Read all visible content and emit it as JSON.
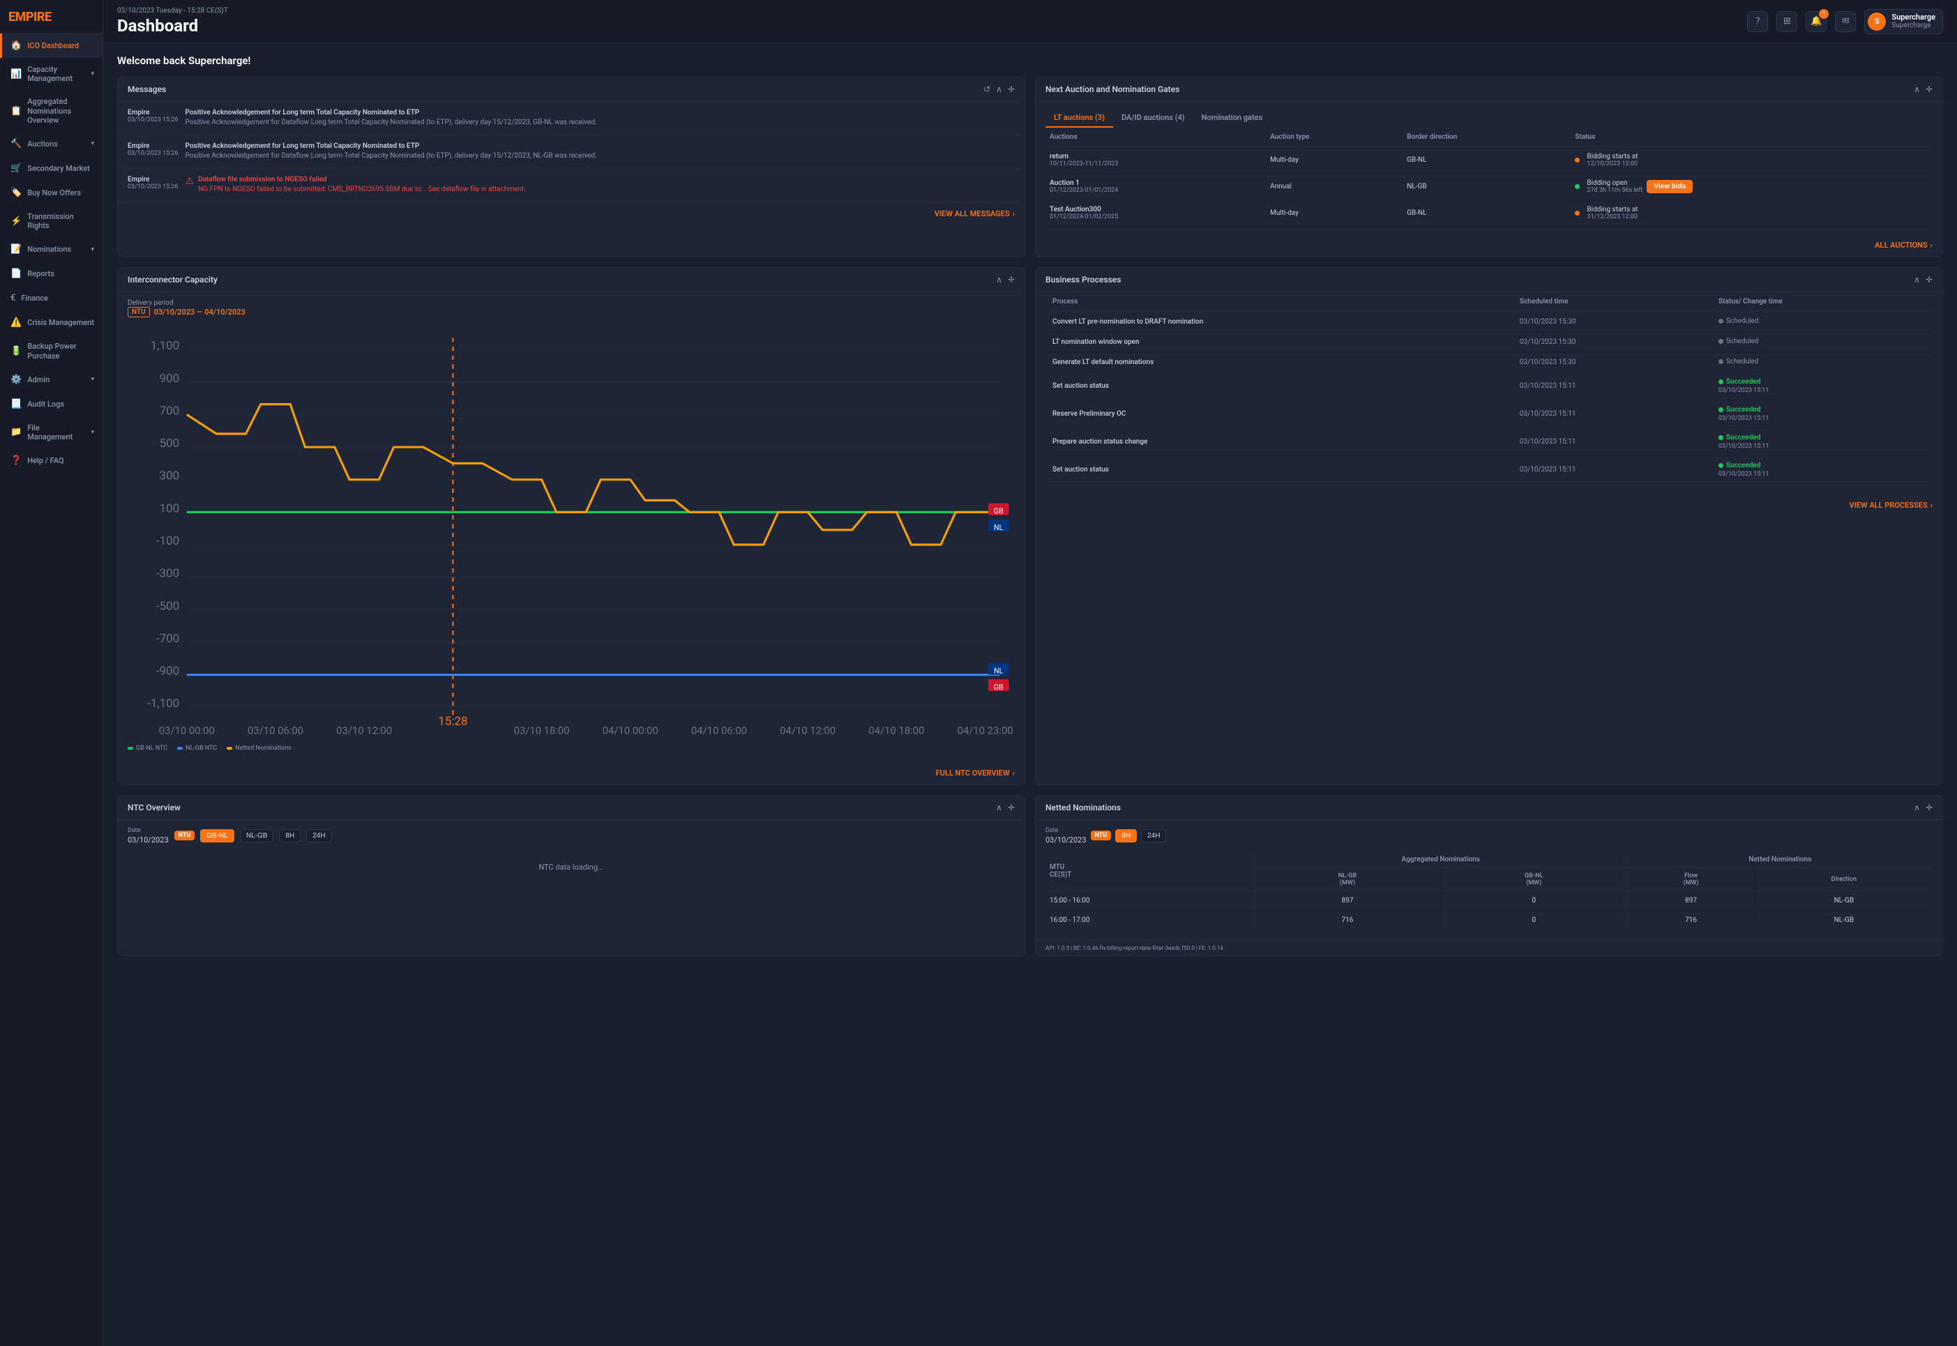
{
  "logo": {
    "text": "EMPIR",
    "accent": "E"
  },
  "header": {
    "datetime": "03/10/2023 Tuesday - 15:28 CE(S)T",
    "title": "Dashboard",
    "user": {
      "name": "Supercharge",
      "sub": "Supercharge",
      "initial": "S"
    }
  },
  "welcome": "Welcome back Supercharge!",
  "sidebar": {
    "items": [
      {
        "id": "ico-dashboard",
        "icon": "🏠",
        "label": "ICO Dashboard",
        "active": true,
        "chevron": false
      },
      {
        "id": "capacity-management",
        "icon": "📊",
        "label": "Capacity Management",
        "active": false,
        "chevron": true
      },
      {
        "id": "aggregated-nominations",
        "icon": "📋",
        "label": "Aggregated Nominations Overview",
        "active": false,
        "chevron": false
      },
      {
        "id": "auctions",
        "icon": "🔨",
        "label": "Auctions",
        "active": false,
        "chevron": true
      },
      {
        "id": "secondary-market",
        "icon": "🛒",
        "label": "Secondary Market",
        "active": false,
        "chevron": false
      },
      {
        "id": "buy-now-offers",
        "icon": "🏷️",
        "label": "Buy Now Offers",
        "active": false,
        "chevron": false
      },
      {
        "id": "transmission-rights",
        "icon": "⚡",
        "label": "Transmission Rights",
        "active": false,
        "chevron": false
      },
      {
        "id": "nominations",
        "icon": "📝",
        "label": "Nominations",
        "active": false,
        "chevron": true
      },
      {
        "id": "reports",
        "icon": "📄",
        "label": "Reports",
        "active": false,
        "chevron": false
      },
      {
        "id": "finance",
        "icon": "€",
        "label": "Finance",
        "active": false,
        "chevron": false
      },
      {
        "id": "crisis-management",
        "icon": "⚠️",
        "label": "Crisis Management",
        "active": false,
        "chevron": false
      },
      {
        "id": "backup-power",
        "icon": "🔋",
        "label": "Backup Power Purchase",
        "active": false,
        "chevron": false
      },
      {
        "id": "admin",
        "icon": "⚙️",
        "label": "Admin",
        "active": false,
        "chevron": true
      },
      {
        "id": "audit-logs",
        "icon": "📃",
        "label": "Audit Logs",
        "active": false,
        "chevron": false
      },
      {
        "id": "file-management",
        "icon": "📁",
        "label": "File Management",
        "active": false,
        "chevron": true
      },
      {
        "id": "help",
        "icon": "❓",
        "label": "Help / FAQ",
        "active": false,
        "chevron": false
      }
    ]
  },
  "messages": {
    "title": "Messages",
    "items": [
      {
        "sender": "Empire",
        "time": "03/10/2023 15:26",
        "title": "Positive Acknowledgement for Long term Total Capacity Nominated to ETP",
        "body": "Positive Acknowledgement for Dataflow Long term Total Capacity Nominated (to ETP), delivery day 15/12/2023, GB-NL was received.",
        "error": false
      },
      {
        "sender": "Empire",
        "time": "03/10/2023 15:26",
        "title": "Positive Acknowledgement for Long term Total Capacity Nominated to ETP",
        "body": "Positive Acknowledgement for Dataflow Long term Total Capacity Nominated (to ETP), delivery day 15/12/2023, NL-GB was received.",
        "error": false
      },
      {
        "sender": "Empire",
        "time": "03/10/2023 15:26",
        "title": "Dataflow file submission to NGESO failed",
        "body": "NG FPN to NGESO failed to be submitted: CMS_BRTND2695.SBM due to: . See dataflow file in attachment.",
        "error": true
      }
    ],
    "view_all": "VIEW ALL MESSAGES"
  },
  "auctions": {
    "title": "Next Auction and Nomination Gates",
    "tabs": [
      {
        "id": "lt",
        "label": "LT auctions (3)",
        "active": true
      },
      {
        "id": "da-id",
        "label": "DA/ID auctions (4)",
        "active": false
      },
      {
        "id": "nomination-gates",
        "label": "Nomination gates",
        "active": false
      }
    ],
    "columns": [
      "Auctions",
      "Auction type",
      "Border direction",
      "Status"
    ],
    "rows": [
      {
        "name": "return",
        "dates": "10/11/2023-11/11/2023",
        "type": "Multi-day",
        "border": "GB-NL",
        "status": "Bidding starts at",
        "status_date": "12/10/2023 12:00",
        "status_type": "orange",
        "has_btn": false
      },
      {
        "name": "Auction 1",
        "dates": "01/12/2023-01/01/2024",
        "type": "Annual",
        "border": "NL-GB",
        "status": "Bidding open",
        "status_date": "27d 3h 11m 56s left",
        "status_type": "green",
        "has_btn": true
      },
      {
        "name": "Test Auction300",
        "dates": "01/12/2024-01/02/2025",
        "type": "Multi-day",
        "border": "GB-NL",
        "status": "Bidding starts at",
        "status_date": "31/12/2023 12:00",
        "status_type": "orange",
        "has_btn": false
      }
    ],
    "all_label": "ALL AUCTIONS",
    "btn_label": "View bids"
  },
  "chart": {
    "title": "Interconnector Capacity",
    "delivery_label": "Delivery period",
    "date_range": "03/10/2023 — 04/10/2023",
    "legend": [
      {
        "color": "#22c55e",
        "label": "GB-NL NTC"
      },
      {
        "color": "#3b82f6",
        "label": "NL-GB NTC"
      },
      {
        "color": "#f59e0b",
        "label": "Netted Nominations"
      }
    ],
    "full_link": "FULL NTC OVERVIEW",
    "y_labels": [
      "1,100",
      "900",
      "700",
      "500",
      "300",
      "100",
      "-100",
      "-300",
      "-500",
      "-700",
      "-900",
      "-1,100"
    ],
    "x_labels": [
      "03/10 00:00",
      "03/10 06:00",
      "03/10 12:00",
      "15:28",
      "03/10 18:00",
      "04/10 00:00",
      "04/10 06:00",
      "04/10 12:00",
      "04/10 18:00",
      "04/10 23:00"
    ]
  },
  "business_processes": {
    "title": "Business Processes",
    "columns": [
      "Process",
      "Scheduled time",
      "Status/ Change time"
    ],
    "rows": [
      {
        "name": "Convert LT pre-nomination to DRAFT nomination",
        "time": "03/10/2023 15:30",
        "status": "Scheduled",
        "status_time": "",
        "type": "scheduled"
      },
      {
        "name": "LT nomination window open",
        "time": "03/10/2023 15:30",
        "status": "Scheduled",
        "status_time": "",
        "type": "scheduled"
      },
      {
        "name": "Generate LT default nominations",
        "time": "03/10/2023 15:30",
        "status": "Scheduled",
        "status_time": "",
        "type": "scheduled"
      },
      {
        "name": "Set auction status",
        "time": "03/10/2023 15:11",
        "status": "Succeeded",
        "status_time": "03/10/2023 15:11",
        "type": "succeeded"
      },
      {
        "name": "Reserve Preliminary OC",
        "time": "03/10/2023 15:11",
        "status": "Succeeded",
        "status_time": "03/10/2023 15:11",
        "type": "succeeded"
      },
      {
        "name": "Prepare auction status change",
        "time": "03/10/2023 15:11",
        "status": "Succeeded",
        "status_time": "03/10/2023 15:11",
        "type": "succeeded"
      },
      {
        "name": "Set auction status",
        "time": "03/10/2023 15:11",
        "status": "Succeeded",
        "status_time": "03/10/2023 15:11",
        "type": "succeeded"
      }
    ],
    "view_all": "VIEW ALL PROCESSES"
  },
  "ntc_overview": {
    "title": "NTC Overview",
    "date_label": "Date",
    "date_value": "03/10/2023",
    "filters": [
      "NTU",
      "GB-NL",
      "NL-GB",
      "8H",
      "24H"
    ]
  },
  "netted_nominations": {
    "title": "Netted Nominations",
    "date_label": "Date",
    "date_value": "03/10/2023",
    "time_filters": [
      "NTU",
      "8H",
      "24H"
    ],
    "active_filter": "8H",
    "agg_nom_label": "Aggregated Nominations",
    "netted_nom_label": "Netted Nominations",
    "cols": {
      "mtu": "MTU CE(S)T",
      "nl_gb": "NL-GB (MW)",
      "gb_nl": "GB-NL (MW)",
      "flow": "Flow (MW)",
      "direction": "Direction"
    },
    "rows": [
      {
        "time": "15:00 - 16:00",
        "nl_gb": "897",
        "gb_nl": "0",
        "flow": "897",
        "direction": "NL-GB"
      },
      {
        "time": "16:00 - 17:00",
        "nl_gb": "716",
        "gb_nl": "0",
        "flow": "716",
        "direction": "NL-GB"
      }
    ],
    "api_info": "API: 1.0.5 | BE: 1.0.46-fix-billing-report-date-filter-3aadc f50.0 | FE: 1.0.14"
  }
}
